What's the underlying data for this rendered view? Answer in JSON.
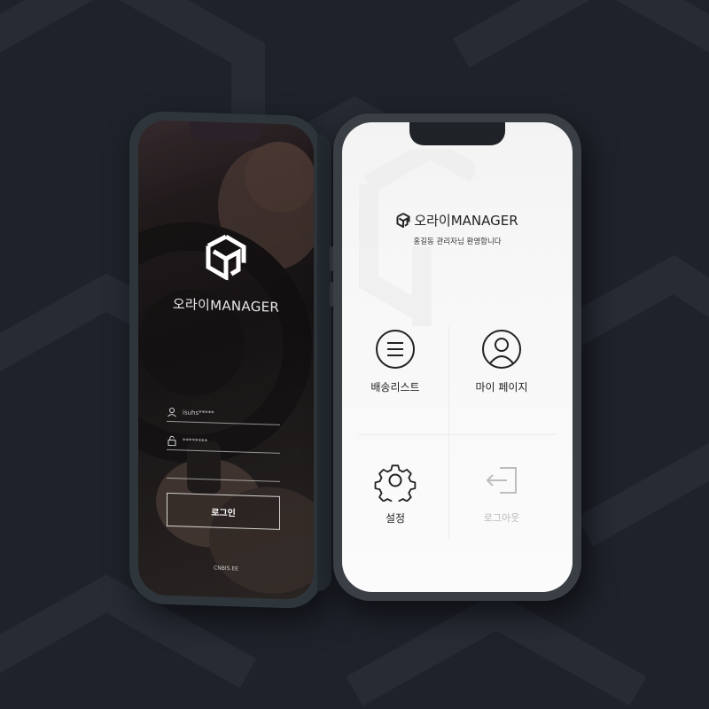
{
  "brand": "오라이MANAGER",
  "login": {
    "brand": "오라이MANAGER",
    "username_value": "isuhs*****",
    "password_value": "********",
    "login_button": "로그인",
    "footer": "CNBIS.EE"
  },
  "menu": {
    "brand": "오라이MANAGER",
    "welcome": "홍길동 관리자님 환영합니다",
    "items": [
      {
        "label": "배송리스트",
        "icon": "list-circle-icon"
      },
      {
        "label": "마이 페이지",
        "icon": "user-circle-icon"
      },
      {
        "label": "설정",
        "icon": "gear-icon"
      },
      {
        "label": "로그아웃",
        "icon": "logout-icon"
      }
    ]
  },
  "colors": {
    "background": "#1e222a",
    "phone_frame": "#3a3f46",
    "screen": "#f7f7f7",
    "logout_disabled": "#b9b9b9"
  }
}
